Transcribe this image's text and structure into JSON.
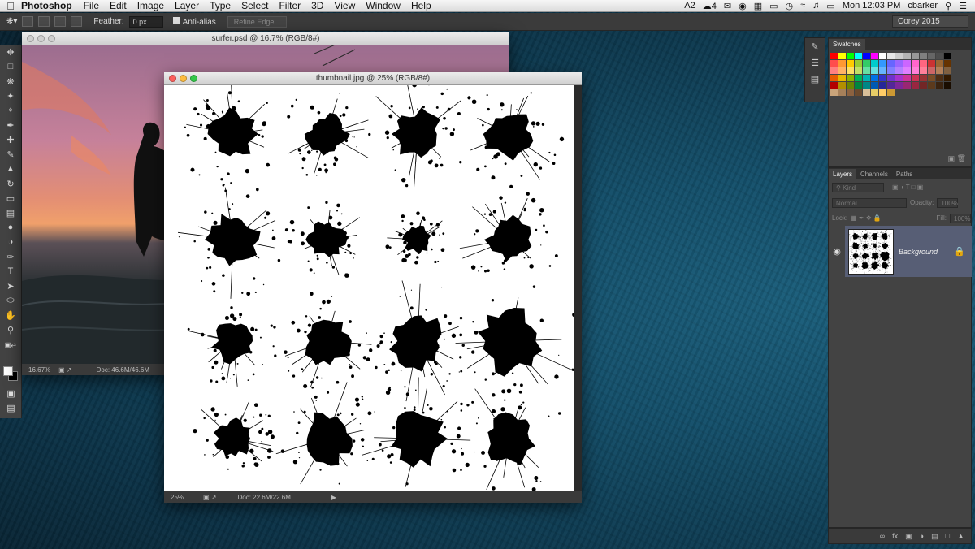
{
  "menubar": {
    "app_name": "Photoshop",
    "menus": [
      "File",
      "Edit",
      "Image",
      "Layer",
      "Type",
      "Select",
      "Filter",
      "3D",
      "View",
      "Window",
      "Help"
    ],
    "status": {
      "adobe_badge": "2",
      "cc_badge": "4",
      "clock": "Mon 12:03 PM",
      "user": "cbarker"
    }
  },
  "options_bar": {
    "feather_label": "Feather:",
    "feather_value": "0 px",
    "anti_alias_label": "Anti-alias",
    "refine_edge_label": "Refine Edge...",
    "workspace": "Corey 2015"
  },
  "documents": {
    "surfer": {
      "title": "surfer.psd @ 16.7% (RGB/8#)",
      "zoom": "16.67%",
      "doc_size": "Doc: 46.6M/46.6M"
    },
    "thumbnail": {
      "title": "thumbnail.jpg @ 25% (RGB/8#)",
      "zoom": "25%",
      "doc_size": "Doc: 22.6M/22.6M"
    }
  },
  "swatches_panel": {
    "tab_label": "Swatches",
    "colors": [
      "#ff0000",
      "#ffff00",
      "#00ff00",
      "#00ffff",
      "#0000ff",
      "#ff00ff",
      "#ffffff",
      "#e6e6e6",
      "#cccccc",
      "#b3b3b3",
      "#999999",
      "#808080",
      "#666666",
      "#4d4d4d",
      "#000000",
      "#ff4d4d",
      "#ff9933",
      "#ffcc00",
      "#99cc33",
      "#33cc66",
      "#00cccc",
      "#3399ff",
      "#6666ff",
      "#9966ff",
      "#cc66ff",
      "#ff66cc",
      "#ff6680",
      "#cc3333",
      "#996633",
      "#663300",
      "#ff8080",
      "#ffb366",
      "#ffe066",
      "#c2e066",
      "#66e0a3",
      "#66e0e0",
      "#66b3ff",
      "#8080ff",
      "#b380ff",
      "#e080ff",
      "#ff80d9",
      "#ff8099",
      "#cc6666",
      "#b38059",
      "#806040",
      "#e65c00",
      "#e6b800",
      "#8fb300",
      "#00b359",
      "#00b3b3",
      "#0073e6",
      "#3333cc",
      "#7033cc",
      "#a633cc",
      "#cc3399",
      "#cc3355",
      "#993333",
      "#7a4d26",
      "#4d2e14",
      "#331a00",
      "#b30000",
      "#b38f00",
      "#6b8600",
      "#008640",
      "#008686",
      "#0059b3",
      "#262699",
      "#532699",
      "#7d2699",
      "#992673",
      "#992640",
      "#732626",
      "#5c3a1c",
      "#3a230f",
      "#1a0d00",
      "#c9a47a",
      "#a6805a",
      "#8c6240",
      "#6b4a2e",
      "#d9bf99",
      "#e6cc66",
      "#ffcc66",
      "#cc9933"
    ]
  },
  "layers_panel": {
    "tabs": [
      "Layers",
      "Channels",
      "Paths"
    ],
    "kind_label": "Kind",
    "blend_mode": "Normal",
    "opacity_label": "Opacity:",
    "opacity_value": "100%",
    "lock_label": "Lock:",
    "fill_label": "Fill:",
    "fill_value": "100%",
    "layer_name": "Background"
  }
}
